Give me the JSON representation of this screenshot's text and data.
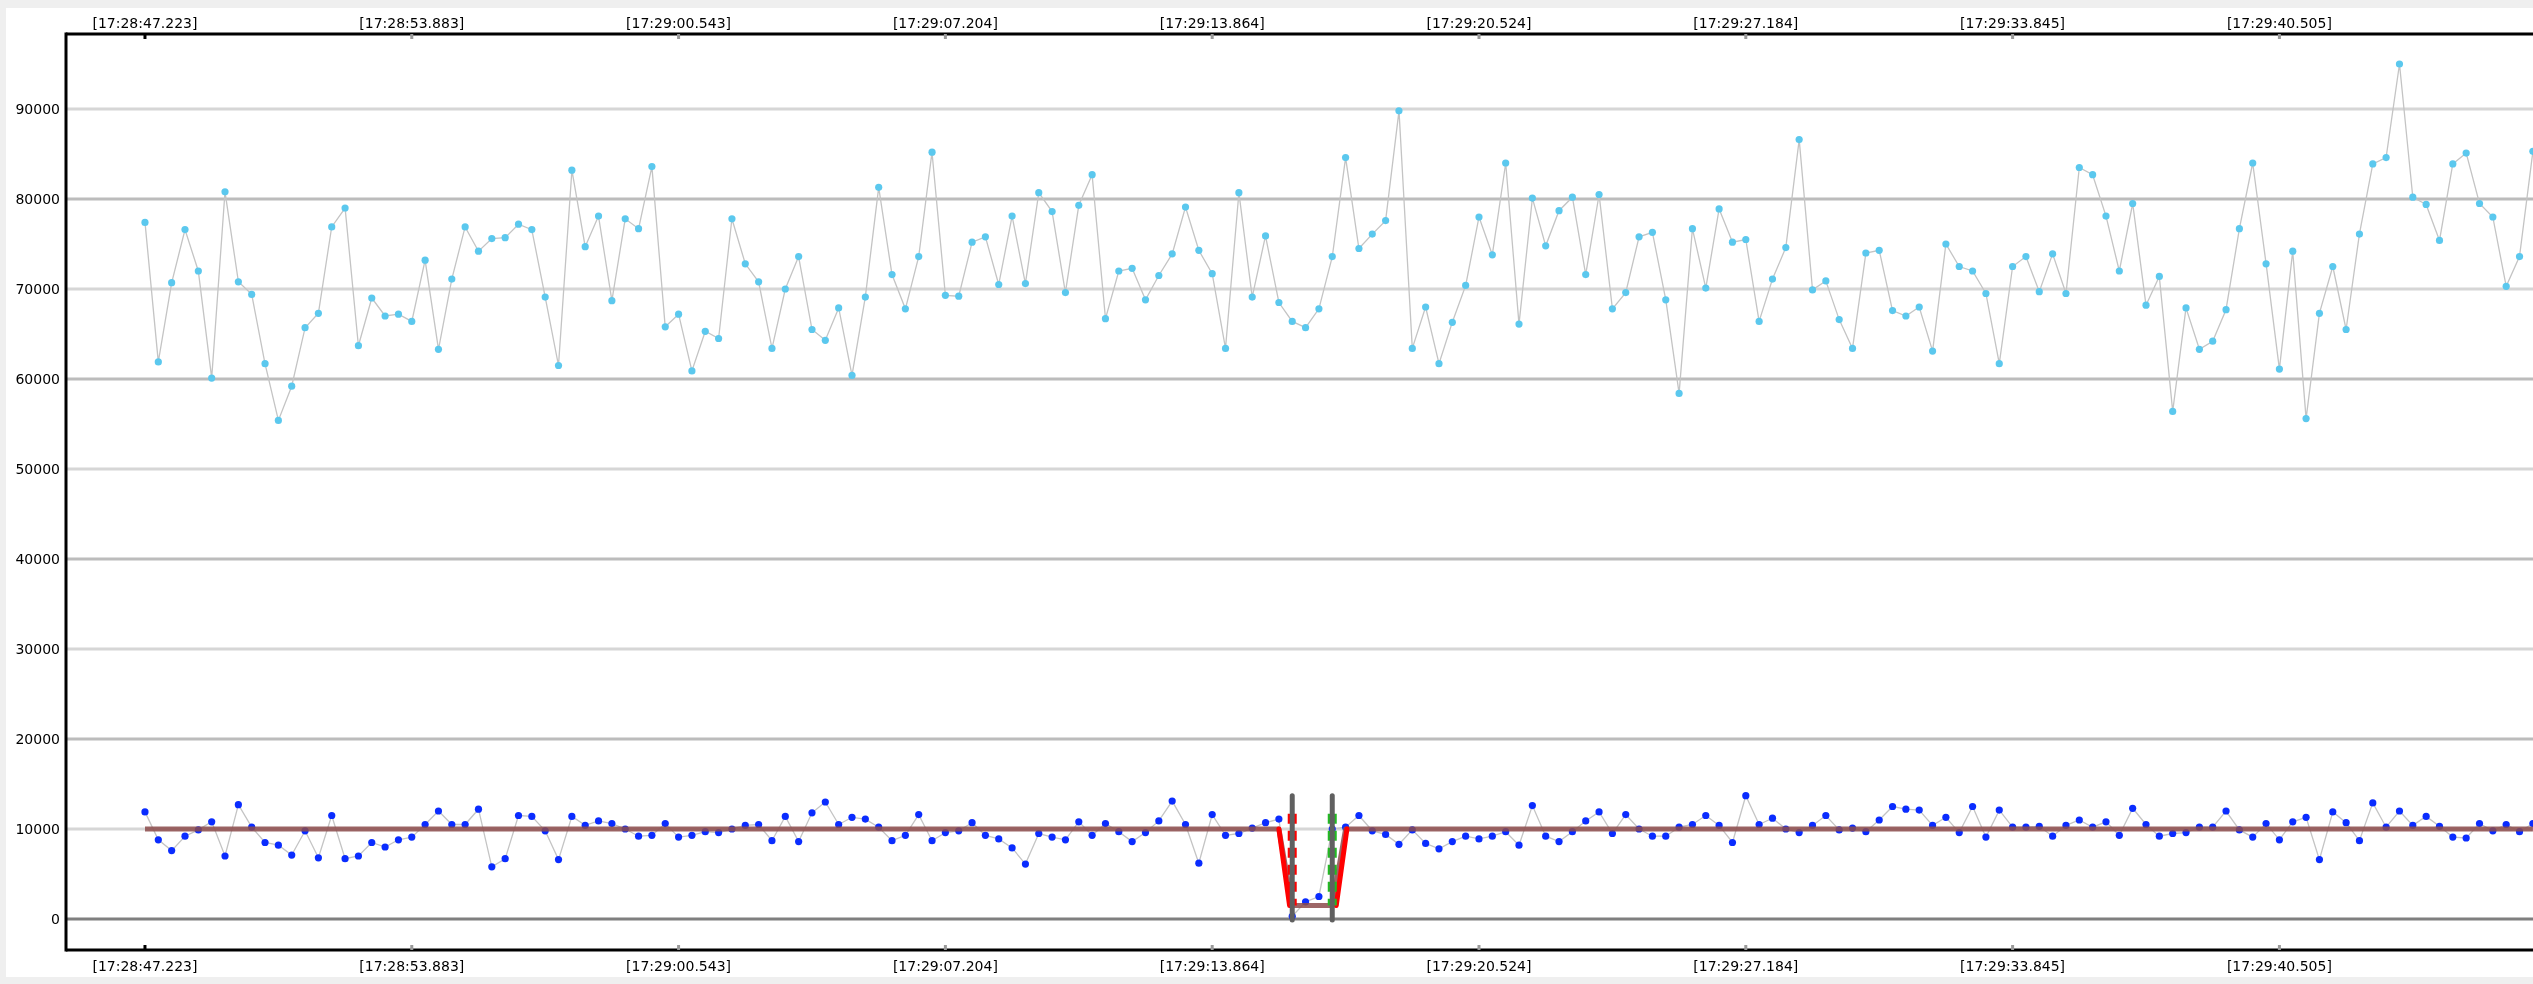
{
  "chart_data": {
    "type": "line",
    "grid": true,
    "categories": [
      "[17:28:47.223]",
      null,
      null,
      null,
      null,
      null,
      null,
      null,
      null,
      null,
      null,
      null,
      null,
      null,
      null,
      null,
      null,
      null,
      null,
      null,
      "[17:28:53.883]",
      null,
      null,
      null,
      null,
      null,
      null,
      null,
      null,
      null,
      null,
      null,
      null,
      null,
      null,
      null,
      null,
      null,
      null,
      null,
      "[17:29:00.543]",
      null,
      null,
      null,
      null,
      null,
      null,
      null,
      null,
      null,
      null,
      null,
      null,
      null,
      null,
      null,
      null,
      null,
      null,
      null,
      "[17:29:07.204]",
      null,
      null,
      null,
      null,
      null,
      null,
      null,
      null,
      null,
      null,
      null,
      null,
      null,
      null,
      null,
      null,
      null,
      null,
      null,
      "[17:29:13.864]",
      null,
      null,
      null,
      null,
      null,
      null,
      null,
      null,
      null,
      null,
      null,
      null,
      null,
      null,
      null,
      null,
      null,
      null,
      null,
      "[17:29:20.524]",
      null,
      null,
      null,
      null,
      null,
      null,
      null,
      null,
      null,
      null,
      null,
      null,
      null,
      null,
      null,
      null,
      null,
      null,
      null,
      "[17:29:27.184]",
      null,
      null,
      null,
      null,
      null,
      null,
      null,
      null,
      null,
      null,
      null,
      null,
      null,
      null,
      null,
      null,
      null,
      null,
      null,
      "[17:29:33.845]",
      null,
      null,
      null,
      null,
      null,
      null,
      null,
      null,
      null,
      null,
      null,
      null,
      null,
      null,
      null,
      null,
      null,
      null,
      null,
      "[17:29:40.505]",
      null,
      null,
      null,
      null,
      null,
      null,
      null,
      null,
      null,
      null,
      null,
      null,
      null,
      null,
      null,
      null,
      null,
      null,
      null
    ],
    "ylim": [
      -3444,
      98333
    ],
    "yticks": [
      0,
      10000,
      20000,
      30000,
      40000,
      50000,
      60000,
      70000,
      80000,
      90000
    ],
    "series": [
      {
        "marker": "o",
        "color": "#5bc8ee",
        "values": [
          77400,
          61900,
          70700,
          76600,
          72000,
          60100,
          80800,
          70800,
          69400,
          61700,
          55400,
          59200,
          65700,
          67300,
          76900,
          79000,
          63700,
          69000,
          67000,
          67200,
          66400,
          73200,
          63300,
          71100,
          76900,
          74200,
          75600,
          75700,
          77200,
          76600,
          69100,
          61500,
          83200,
          74700,
          78100,
          68700,
          77800,
          76700,
          83600,
          65800,
          67200,
          60900,
          65300,
          64500,
          77800,
          72800,
          70800,
          63400,
          70000,
          73600,
          65500,
          64300,
          67900,
          60400,
          69100,
          81300,
          71600,
          67800,
          73600,
          85200,
          69300,
          69200,
          75200,
          75800,
          70500,
          78100,
          70600,
          80700,
          78600,
          69600,
          79300,
          82700,
          66700,
          72000,
          72300,
          68800,
          71500,
          73900,
          79100,
          74300,
          71700,
          63400,
          80700,
          69100,
          75900,
          68500,
          66400,
          65700,
          67800,
          73600,
          84600,
          74500,
          76100,
          77600,
          89800,
          63400,
          68000,
          61700,
          66300,
          70400,
          78000,
          73800,
          84000,
          66100,
          80100,
          74800,
          78700,
          80200,
          71600,
          80500,
          67800,
          69600,
          75800,
          76300,
          68800,
          58400,
          76700,
          70100,
          78900,
          75200,
          75500,
          66400,
          71100,
          74600,
          86600,
          69900,
          70900,
          66600,
          63400,
          74000,
          74300,
          67600,
          67000,
          68000,
          63100,
          75000,
          72500,
          72000,
          69500,
          61700,
          72500,
          73600,
          69700,
          73900,
          69500,
          83500,
          82700,
          78100,
          72000,
          79500,
          68200,
          71400,
          56400,
          67900,
          63300,
          64200,
          67700,
          76700,
          84000,
          72800,
          61100,
          74200,
          55600,
          67300,
          72500,
          65500,
          76100,
          83900,
          84600,
          95000,
          80200,
          79400,
          75400,
          83900,
          85100,
          79500,
          78000,
          70300,
          73600,
          85300
        ]
      },
      {
        "marker": "o",
        "color": "#0a2cff",
        "values": [
          11900,
          8800,
          7600,
          9200,
          9900,
          10800,
          7000,
          12700,
          10200,
          8500,
          8200,
          7100,
          9800,
          6800,
          11500,
          6700,
          7000,
          8500,
          8000,
          8800,
          9100,
          10500,
          12000,
          10500,
          10500,
          12200,
          5800,
          6700,
          11500,
          11400,
          9800,
          6600,
          11400,
          10400,
          10900,
          10600,
          10000,
          9200,
          9300,
          10600,
          9100,
          9300,
          9700,
          9600,
          10000,
          10400,
          10500,
          8700,
          11400,
          8600,
          11800,
          13000,
          10500,
          11300,
          11100,
          10200,
          8700,
          9300,
          11600,
          8700,
          9600,
          9800,
          10700,
          9300,
          8900,
          7900,
          6100,
          9500,
          9100,
          8800,
          10800,
          9300,
          10600,
          9700,
          8600,
          9600,
          10900,
          13100,
          10500,
          6200,
          11600,
          9300,
          9500,
          10100,
          10700,
          11100,
          300,
          1900,
          2500,
          10000,
          10200,
          11500,
          9800,
          9400,
          8300,
          9900,
          8400,
          7800,
          8600,
          9200,
          8900,
          9200,
          9700,
          8200,
          12600,
          9200,
          8600,
          9700,
          10900,
          11900,
          9500,
          11600,
          10000,
          9200,
          9200,
          10200,
          10500,
          11500,
          10400,
          8500,
          13700,
          10500,
          11200,
          10000,
          9600,
          10400,
          11500,
          9900,
          10100,
          9700,
          11000,
          12500,
          12200,
          12100,
          10400,
          11300,
          9600,
          12500,
          9100,
          12100,
          10200,
          10200,
          10300,
          9200,
          10400,
          11000,
          10200,
          10800,
          9300,
          12300,
          10500,
          9200,
          9500,
          9600,
          10200,
          10200,
          12000,
          9900,
          9100,
          10600,
          8800,
          10800,
          11300,
          6600,
          11900,
          10700,
          8700,
          12900,
          10200,
          12000,
          10400,
          11400,
          10300,
          9100,
          9000,
          10600,
          9800,
          10500,
          9700,
          10600
        ]
      },
      {
        "color": "#8c4b4b",
        "values": [
          10000,
          10000,
          10000,
          10000,
          10000,
          10000,
          10000,
          10000,
          10000,
          10000,
          10000,
          10000,
          10000,
          10000,
          10000,
          10000,
          10000,
          10000,
          10000,
          10000,
          10000,
          10000,
          10000,
          10000,
          10000,
          10000,
          10000,
          10000,
          10000,
          10000,
          10000,
          10000,
          10000,
          10000,
          10000,
          10000,
          10000,
          10000,
          10000,
          10000,
          10000,
          10000,
          10000,
          10000,
          10000,
          10000,
          10000,
          10000,
          10000,
          10000,
          10000,
          10000,
          10000,
          10000,
          10000,
          10000,
          10000,
          10000,
          10000,
          10000,
          10000,
          10000,
          10000,
          10000,
          10000,
          10000,
          10000,
          10000,
          10000,
          10000,
          10000,
          10000,
          10000,
          10000,
          10000,
          10000,
          10000,
          10000,
          10000,
          10000,
          10000,
          10000,
          10000,
          10000,
          10000,
          10000,
          1500,
          1500,
          1500,
          1500,
          10000,
          10000,
          10000,
          10000,
          10000,
          10000,
          10000,
          10000,
          10000,
          10000,
          10000,
          10000,
          10000,
          10000,
          10000,
          10000,
          10000,
          10000,
          10000,
          10000,
          10000,
          10000,
          10000,
          10000,
          10000,
          10000,
          10000,
          10000,
          10000,
          10000,
          10000,
          10000,
          10000,
          10000,
          10000,
          10000,
          10000,
          10000,
          10000,
          10000,
          10000,
          10000,
          10000,
          10000,
          10000,
          10000,
          10000,
          10000,
          10000,
          10000,
          10000,
          10000,
          10000,
          10000,
          10000,
          10000,
          10000,
          10000,
          10000,
          10000,
          10000,
          10000,
          10000,
          10000,
          10000,
          10000,
          10000,
          10000,
          10000,
          10000,
          10000,
          10000,
          10000,
          10000,
          10000,
          10000,
          10000,
          10000,
          10000,
          10000,
          10000,
          10000,
          10000,
          10000,
          10000,
          10000,
          10000,
          10000,
          10000,
          10000
        ]
      }
    ]
  },
  "top_axis_labels": [
    "[17:28:47.223]",
    "[17:28:53.883]",
    "[17:29:00.543]",
    "[17:29:07.204]",
    "[17:29:13.864]",
    "[17:29:20.524]",
    "[17:29:27.184]",
    "[17:29:33.845]",
    "[17:29:40.505]"
  ]
}
